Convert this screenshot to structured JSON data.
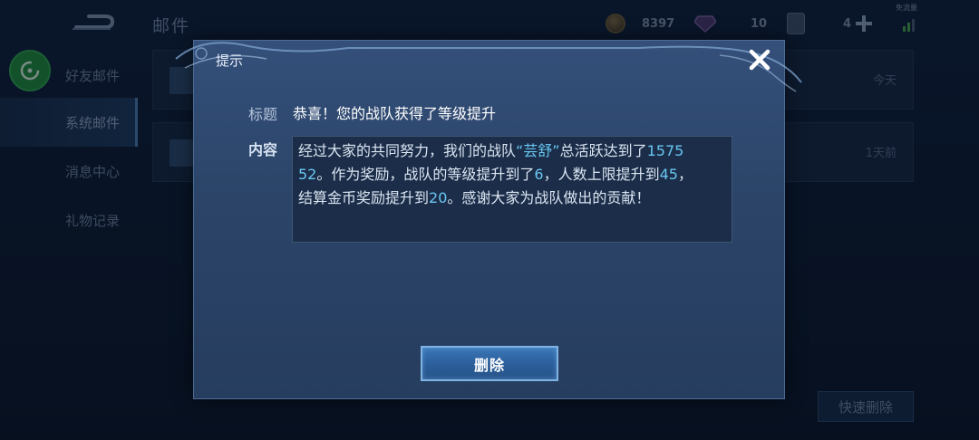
{
  "header": {
    "page_title": "邮件",
    "gold": "8397",
    "gems": "10",
    "tickets": "4",
    "traffic_label": "免流量"
  },
  "sidebar": {
    "items": [
      {
        "label": "好友邮件",
        "active": false
      },
      {
        "label": "系统邮件",
        "active": true
      },
      {
        "label": "消息中心",
        "active": false
      },
      {
        "label": "礼物记录",
        "active": false
      }
    ]
  },
  "mail_list": [
    {
      "time": "今天"
    },
    {
      "time": "1天前"
    }
  ],
  "quick_delete_label": "快速删除",
  "dialog": {
    "title": "提示",
    "subject_label": "标题",
    "subject": "恭喜！您的战队获得了等级提升",
    "content_label": "内容",
    "content": {
      "p1": "经过大家的共同努力，我们的战队",
      "team_name": "“芸舒”",
      "p2": "总活跃达到了",
      "activity_a": "1575",
      "activity_b": "52",
      "p3": "。作为奖励，战队的等级提升到了",
      "level": "6",
      "p4": "，人数上限提升到",
      "member_cap": "45",
      "p5": "，结算金币奖励提升到",
      "gold_reward": "20",
      "p6": "。感谢大家为战队做出的贡献！"
    },
    "delete_label": "删除"
  },
  "colors": {
    "accent": "#69c6f2",
    "dialog_bg": "#2b4468",
    "button": "#2c5f9b"
  }
}
